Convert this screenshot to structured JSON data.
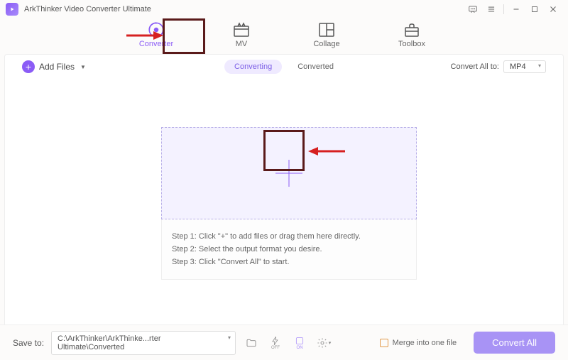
{
  "app": {
    "title": "ArkThinker Video Converter Ultimate"
  },
  "nav": {
    "converter": "Converter",
    "mv": "MV",
    "collage": "Collage",
    "toolbox": "Toolbox"
  },
  "toolbar": {
    "add_files": "Add Files",
    "converting": "Converting",
    "converted": "Converted",
    "convert_all_to": "Convert All to:",
    "format": "MP4"
  },
  "dropzone": {
    "step1": "Step 1: Click \"+\" to add files or drag them here directly.",
    "step2": "Step 2: Select the output format you desire.",
    "step3": "Step 3: Click \"Convert All\" to start."
  },
  "bottom": {
    "save_to": "Save to:",
    "path": "C:\\ArkThinker\\ArkThinke...rter Ultimate\\Converted",
    "merge": "Merge into one file",
    "convert_all": "Convert All",
    "off": "OFF",
    "on": "ON"
  }
}
